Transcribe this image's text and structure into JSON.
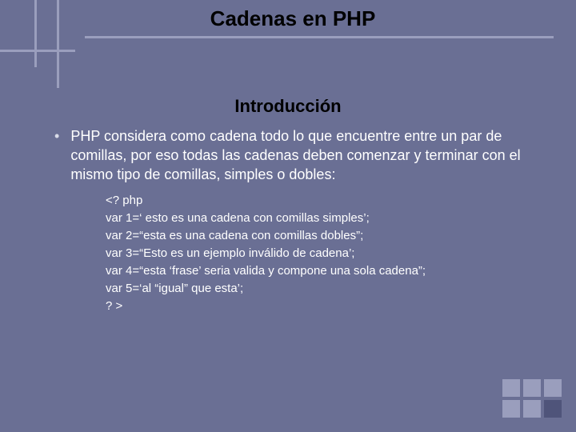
{
  "title": "Cadenas en PHP",
  "subtitle": "Introducción",
  "bullet": "PHP considera como cadena todo lo que encuentre entre un par de comillas, por eso todas las cadenas deben comenzar y terminar con el mismo tipo de comillas, simples o dobles:",
  "code": {
    "l1": "<? php",
    "l2": "var 1=‘ esto es una cadena con comillas simples’;",
    "l3": "var 2=“esta es una cadena con comillas dobles”;",
    "l4": "var 3=“Esto es un ejemplo inválido de cadena’;",
    "l5": "var 4=“esta ‘frase’ seria valida y compone una sola cadena”;",
    "l6": "var 5=‘al “igual” que esta’;",
    "l7": "? >"
  }
}
